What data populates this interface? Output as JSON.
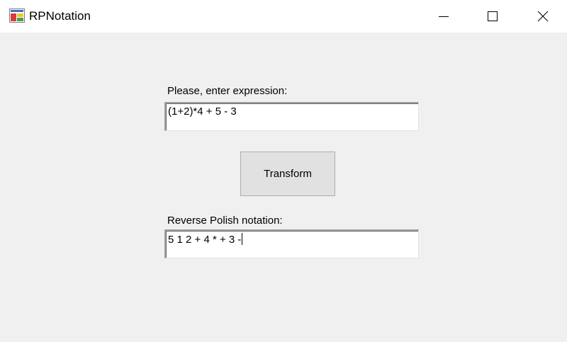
{
  "window": {
    "title": "RPNotation",
    "icon": "winforms-app-icon",
    "controls": {
      "minimize_icon": "minimize-icon",
      "maximize_icon": "maximize-icon",
      "close_icon": "close-icon"
    }
  },
  "form": {
    "expression_label": "Please, enter expression:",
    "expression_value": "(1+2)*4 + 5 - 3",
    "transform_button": "Transform",
    "rpn_label": "Reverse Polish notation:",
    "rpn_value": "5 1 2 + 4 * + 3 -"
  },
  "colors": {
    "background": "#f0f0f0",
    "titlebar": "#ffffff",
    "button_face": "#e1e1e1",
    "button_border": "#adadad"
  }
}
